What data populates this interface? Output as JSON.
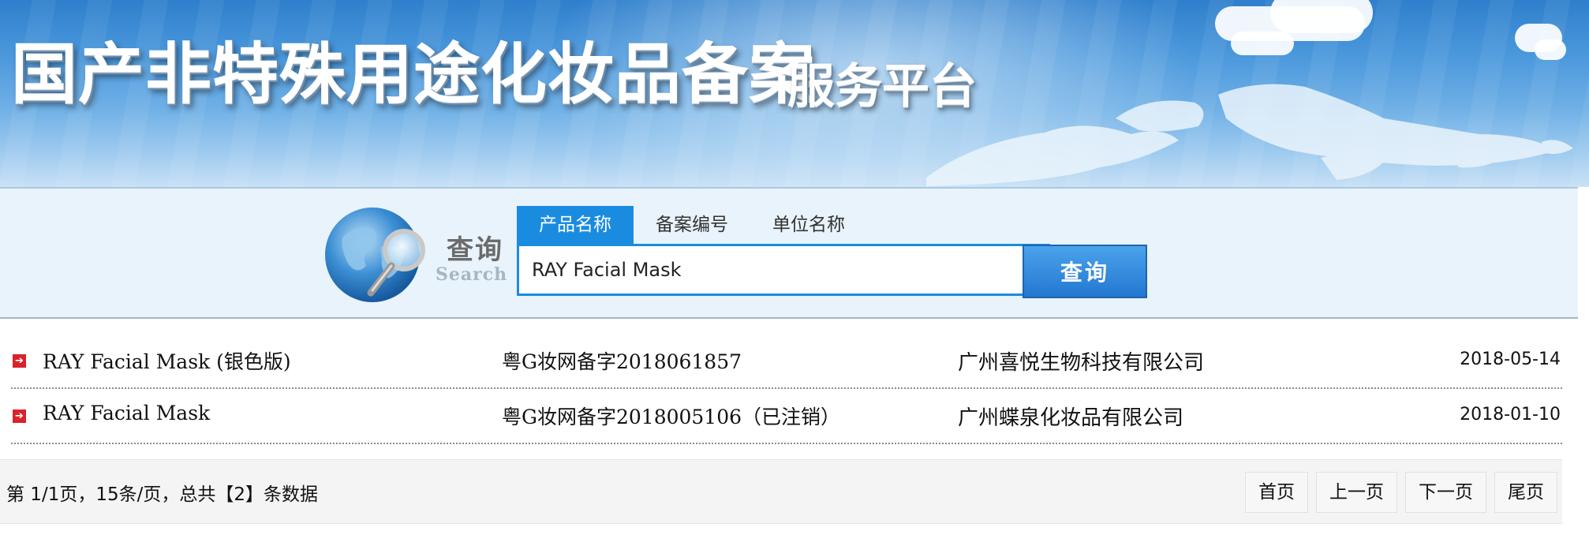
{
  "banner": {
    "title": "国产非特殊用途化妆品备案",
    "subtitle": "服务平台"
  },
  "search": {
    "logo_cn": "查询",
    "logo_en": "Search",
    "tabs": [
      {
        "label": "产品名称",
        "active": true
      },
      {
        "label": "备案编号",
        "active": false
      },
      {
        "label": "单位名称",
        "active": false
      }
    ],
    "query_value": "RAY Facial Mask",
    "button_label": "查询",
    "accent_color": "#1a8ce0"
  },
  "results": [
    {
      "name": "RAY Facial Mask (银色版)",
      "record_no": "粤G妆网备字2018061857",
      "company": "广州喜悦生物科技有限公司",
      "date": "2018-05-14"
    },
    {
      "name": "RAY Facial Mask",
      "record_no": "粤G妆网备字2018005106（已注销）",
      "company": "广州蝶泉化妆品有限公司",
      "date": "2018-01-10"
    }
  ],
  "pager": {
    "info": "第 1/1页，15条/页，总共【2】条数据",
    "first": "首页",
    "prev": "上一页",
    "next": "下一页",
    "last": "尾页"
  },
  "icons": {
    "row_icon": "red-arrow-icon",
    "logo_icon": "globe-magnifier-icon"
  }
}
